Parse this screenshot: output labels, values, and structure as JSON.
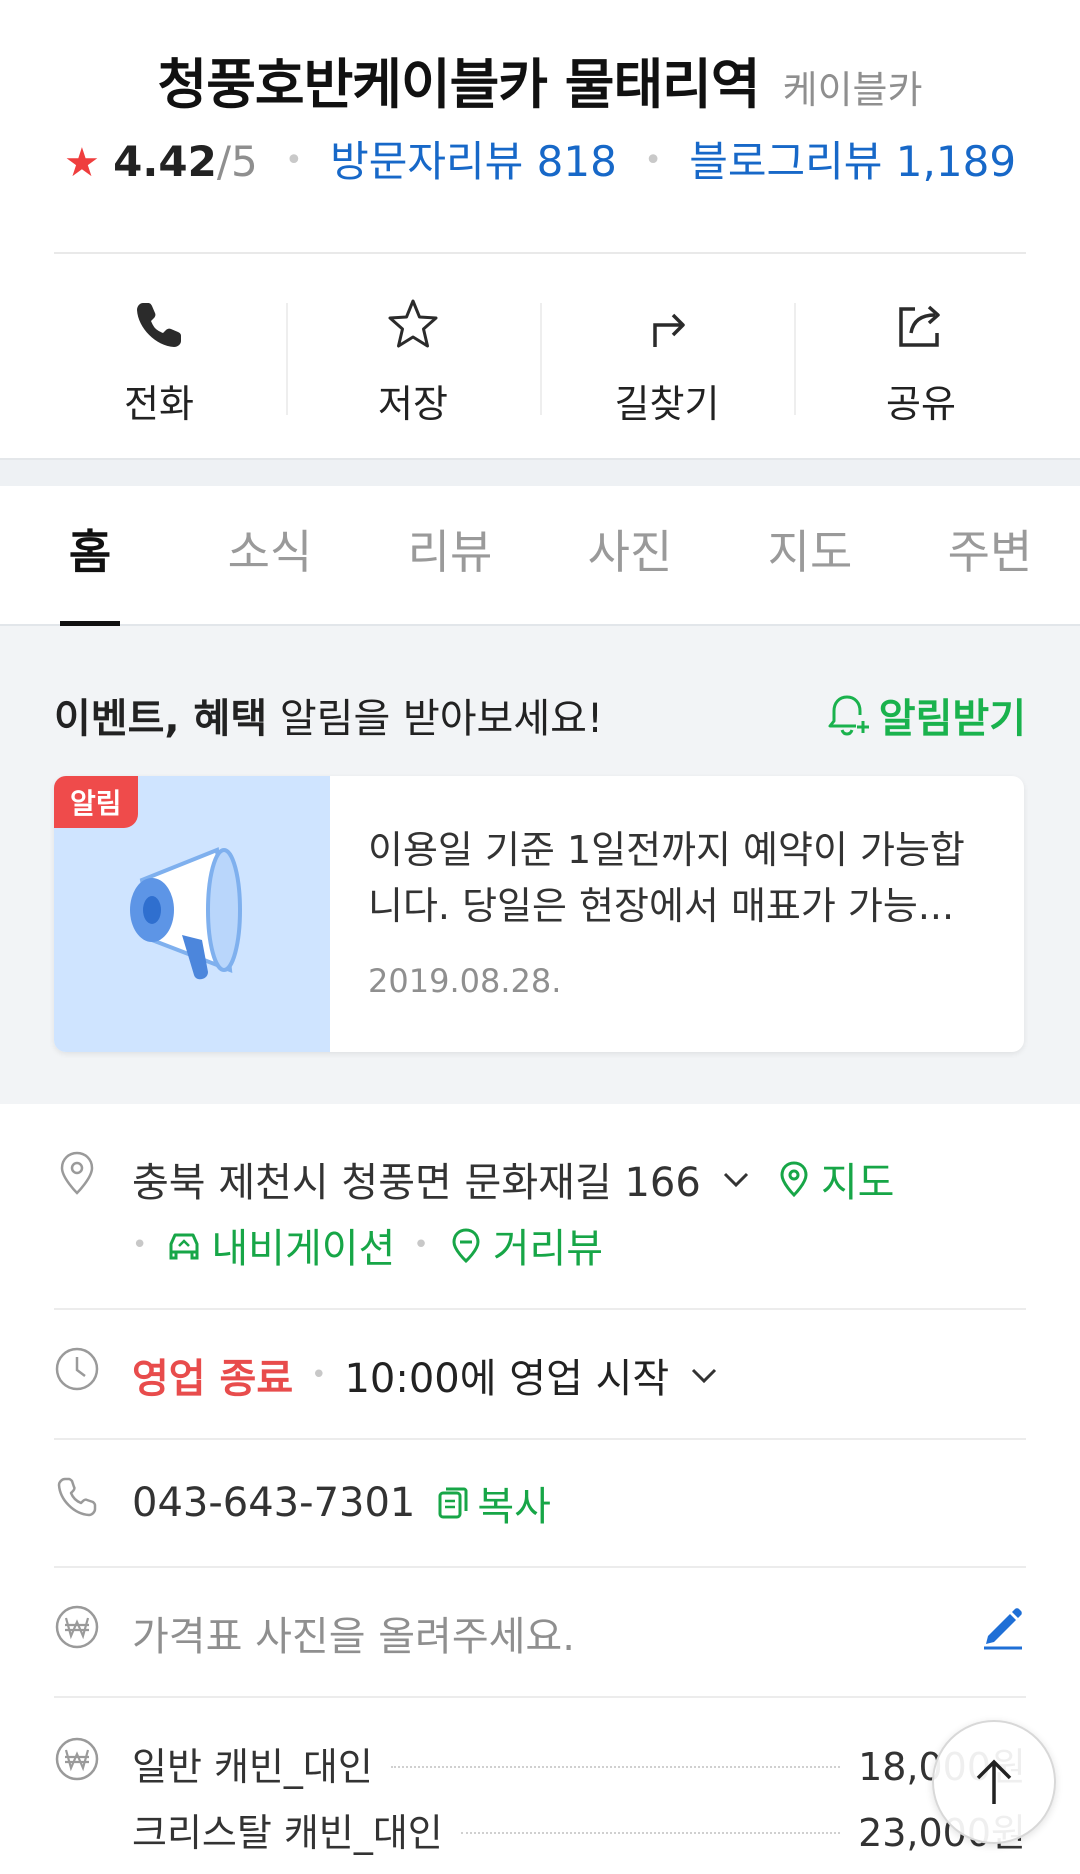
{
  "header": {
    "place_name": "청풍호반케이블카 물태리역",
    "category": "케이블카",
    "rating": "4.42",
    "rating_max": "/5",
    "visitor_reviews_label": "방문자리뷰 818",
    "blog_reviews_label": "블로그리뷰 1,189"
  },
  "actions": [
    {
      "label": "전화",
      "icon": "phone-icon"
    },
    {
      "label": "저장",
      "icon": "star-icon"
    },
    {
      "label": "길찾기",
      "icon": "directions-icon"
    },
    {
      "label": "공유",
      "icon": "share-icon"
    }
  ],
  "tabs": [
    {
      "label": "홈",
      "active": true
    },
    {
      "label": "소식",
      "active": false
    },
    {
      "label": "리뷰",
      "active": false
    },
    {
      "label": "사진",
      "active": false
    },
    {
      "label": "지도",
      "active": false
    },
    {
      "label": "주변",
      "active": false
    }
  ],
  "notification": {
    "title_bold": "이벤트, 혜택",
    "title_rest": " 알림을 받아보세요!",
    "subscribe_label": "알림받기",
    "card": {
      "badge": "알림",
      "text": "이용일 기준 1일전까지 예약이 가능합니다. 당일은 현장에서 매표가 가능...",
      "date": "2019.08.28."
    }
  },
  "address": {
    "text": "충북 제천시 청풍면 문화재길 166",
    "map_label": "지도",
    "navigation_label": "내비게이션",
    "street_view_label": "거리뷰"
  },
  "hours": {
    "status": "영업 종료",
    "next": "10:00에 영업 시작"
  },
  "phone": {
    "number": "043-643-7301",
    "copy_label": "복사"
  },
  "price": {
    "upload_prompt": "가격표 사진을 올려주세요.",
    "items": [
      {
        "name": "일반 캐빈_대인",
        "price": "18,000원"
      },
      {
        "name": "크리스탈 캐빈_대인",
        "price": "23,000원"
      }
    ]
  },
  "colors": {
    "accent_green": "#17a647",
    "link_blue": "#1768c8",
    "closed_red": "#e84c4c",
    "badge_red": "#ef4b4b"
  }
}
